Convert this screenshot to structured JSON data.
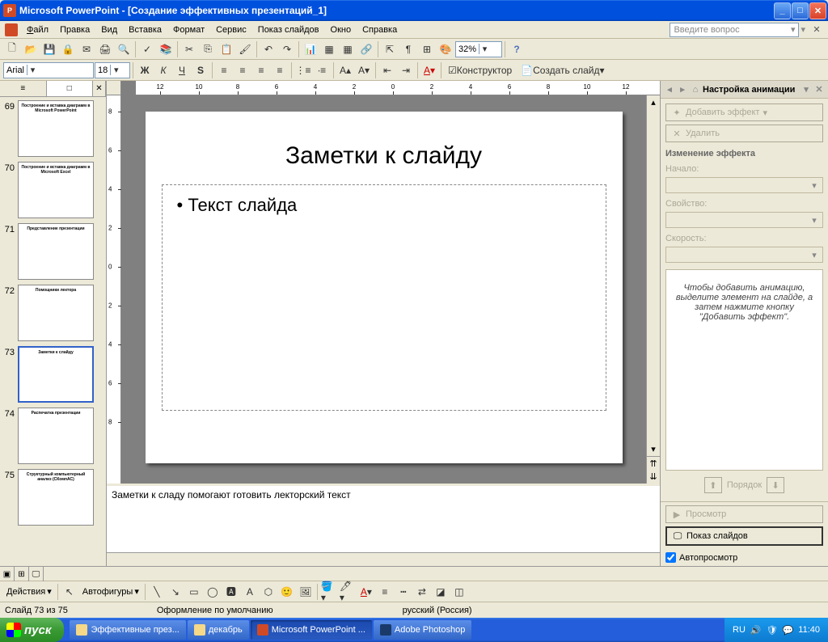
{
  "window": {
    "app_name": "Microsoft PowerPoint",
    "doc_title": "[Создание эффективных презентаций_1]"
  },
  "menu": {
    "file": "Файл",
    "edit": "Правка",
    "view": "Вид",
    "insert": "Вставка",
    "format": "Формат",
    "tools": "Сервис",
    "slideshow": "Показ слайдов",
    "window": "Окно",
    "help": "Справка",
    "ask_placeholder": "Введите вопрос"
  },
  "format_toolbar": {
    "font": "Arial",
    "size": "18",
    "zoom": "32%",
    "designer": "Конструктор",
    "new_slide": "Создать слайд"
  },
  "thumbs": {
    "tab_outline": "≡",
    "tab_slides": "□",
    "slides": [
      {
        "num": 69,
        "title": "Построение и вставка диаграмм в Microsoft PowerPoint"
      },
      {
        "num": 70,
        "title": "Построение и вставка диаграмм в Microsoft Excel"
      },
      {
        "num": 71,
        "title": "Представление презентации"
      },
      {
        "num": 72,
        "title": "Помощники лектора"
      },
      {
        "num": 73,
        "title": "Заметки к слайду",
        "selected": true
      },
      {
        "num": 74,
        "title": "Распечатка презентации"
      },
      {
        "num": 75,
        "title": "Структурный компьютерный анализ (СКомпАС)"
      }
    ]
  },
  "slide": {
    "title": "Заметки к слайду",
    "bullet1": "Текст слайда"
  },
  "notes": {
    "text": "Заметки к сладу помогают готовить лекторский текст"
  },
  "taskpane": {
    "title": "Настройка анимации",
    "add_effect": "Добавить эффект",
    "delete": "Удалить",
    "change_section": "Изменение эффекта",
    "start_lbl": "Начало:",
    "property_lbl": "Свойство:",
    "speed_lbl": "Скорость:",
    "hint": "Чтобы добавить анимацию, выделите элемент на слайде, а затем нажмите кнопку \"Добавить эффект\".",
    "order": "Порядок",
    "preview": "Просмотр",
    "slideshow": "Показ слайдов",
    "autopreview": "Автопросмотр"
  },
  "drawbar": {
    "actions": "Действия",
    "autoshapes": "Автофигуры"
  },
  "status": {
    "slide": "Слайд 73 из 75",
    "design": "Оформление по умолчанию",
    "lang": "русский (Россия)"
  },
  "taskbar": {
    "start": "пуск",
    "tasks": [
      {
        "label": "Эффективные през...",
        "icon": "folder"
      },
      {
        "label": "декабрь",
        "icon": "folder"
      },
      {
        "label": "Microsoft PowerPoint ...",
        "icon": "ppt",
        "active": true
      },
      {
        "label": "Adobe Photoshop",
        "icon": "ps"
      }
    ],
    "lang": "RU",
    "time": "11:40"
  }
}
